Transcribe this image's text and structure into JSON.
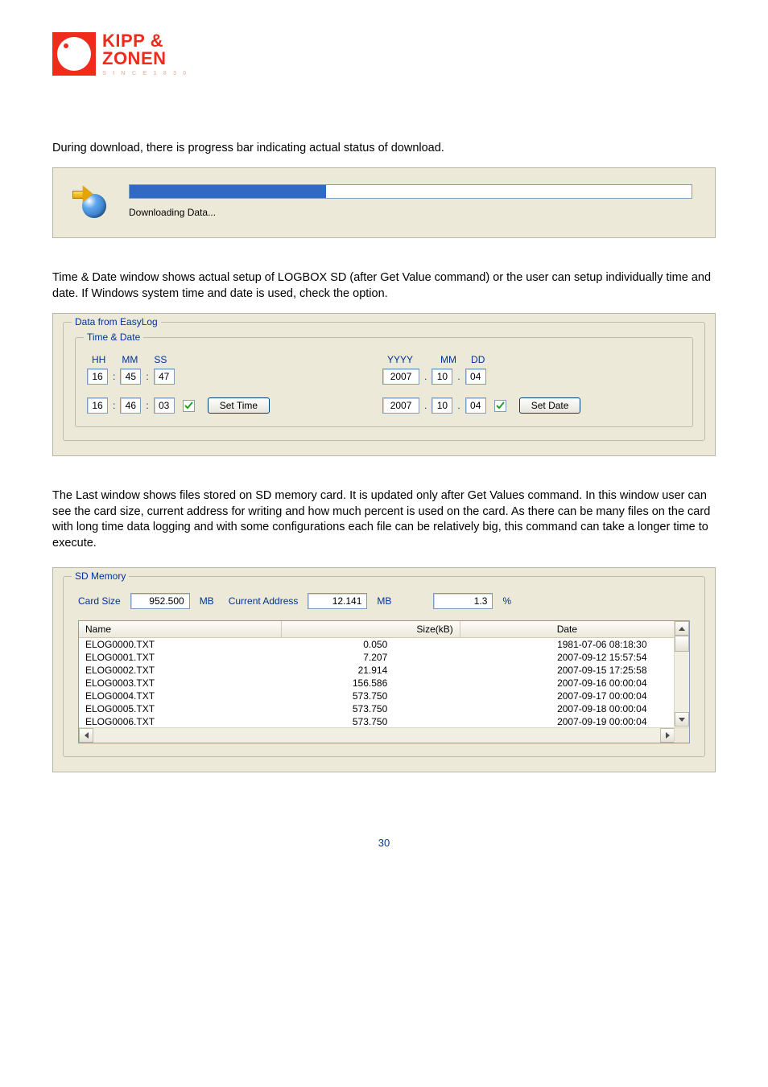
{
  "logo": {
    "line1": "KIPP &",
    "line2": "ZONEN",
    "since": "S I N C E   1 8 3 0"
  },
  "text": {
    "p1": "During download, there is progress bar indicating actual status of download.",
    "p2": "Time & Date window shows actual setup of LOGBOX SD (after Get Value command) or the user can setup individually time and date. If Windows system time and date is used, check the option.",
    "p3": "The Last window shows files stored on SD memory card. It is updated only after Get Values command. In this window user can see the card size, current address for writing and how much percent is used on the card. As there can be many files on the card with long time data logging and with some configurations each file can be relatively big, this command can take a longer time to execute."
  },
  "dialog": {
    "label": "Downloading Data..."
  },
  "timeDate": {
    "outer_legend": "Data from EasyLog",
    "inner_legend": "Time & Date",
    "time_headers": [
      "HH",
      "MM",
      "SS"
    ],
    "date_headers": [
      "YYYY",
      "MM",
      "DD"
    ],
    "time_current": {
      "hh": "16",
      "mm": "45",
      "ss": "47"
    },
    "date_current": {
      "yyyy": "2007",
      "mm": "10",
      "dd": "04"
    },
    "time_set": {
      "hh": "16",
      "mm": "46",
      "ss": "03"
    },
    "date_set": {
      "yyyy": "2007",
      "mm": "10",
      "dd": "04"
    },
    "set_time_btn": "Set Time",
    "set_date_btn": "Set Date",
    "time_checked": true,
    "date_checked": true
  },
  "sd": {
    "legend": "SD Memory",
    "card_size_label": "Card Size",
    "card_size": "952.500",
    "mb1": "MB",
    "addr_label": "Current Address",
    "addr": "12.141",
    "mb2": "MB",
    "used": "1.3",
    "pct": "%",
    "columns": {
      "name": "Name",
      "size": "Size(kB)",
      "date": "Date"
    },
    "rows": [
      {
        "name": "ELOG0000.TXT",
        "size": "0.050",
        "date": "1981-07-06 08:18:30"
      },
      {
        "name": "ELOG0001.TXT",
        "size": "7.207",
        "date": "2007-09-12 15:57:54"
      },
      {
        "name": "ELOG0002.TXT",
        "size": "21.914",
        "date": "2007-09-15 17:25:58"
      },
      {
        "name": "ELOG0003.TXT",
        "size": "156.586",
        "date": "2007-09-16 00:00:04"
      },
      {
        "name": "ELOG0004.TXT",
        "size": "573.750",
        "date": "2007-09-17 00:00:04"
      },
      {
        "name": "ELOG0005.TXT",
        "size": "573.750",
        "date": "2007-09-18 00:00:04"
      },
      {
        "name": "ELOG0006.TXT",
        "size": "573.750",
        "date": "2007-09-19 00:00:04"
      }
    ]
  },
  "page_number": "30"
}
